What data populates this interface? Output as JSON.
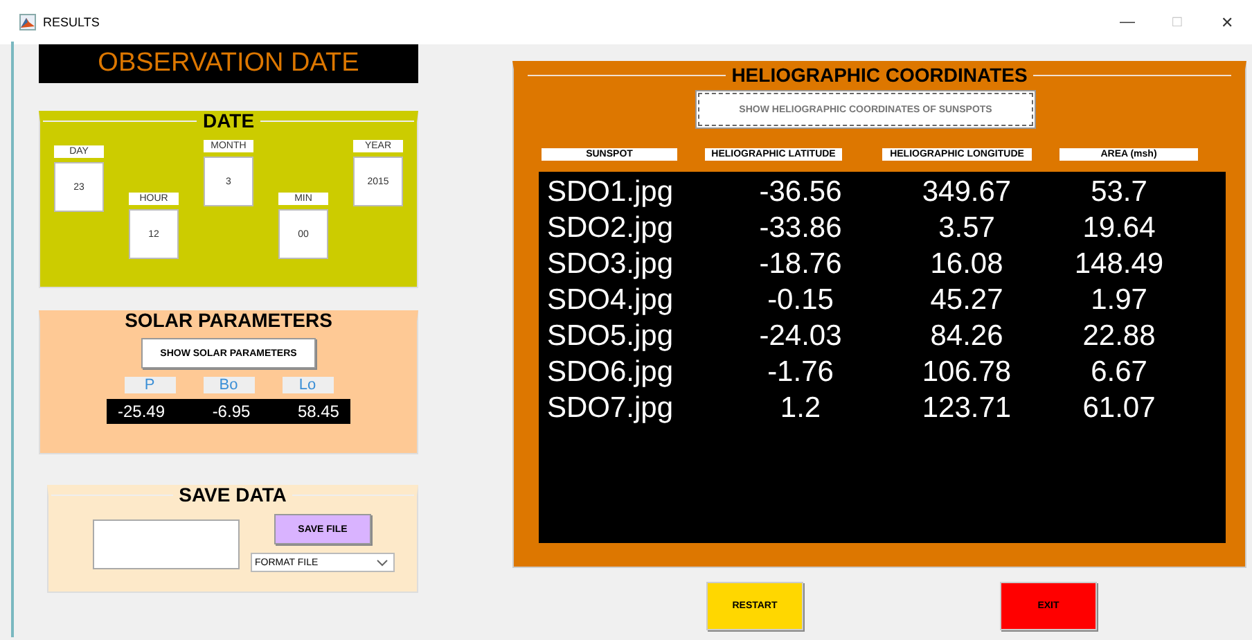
{
  "window": {
    "title": "RESULTS",
    "controls": [
      "—",
      "□",
      "✕"
    ]
  },
  "observation_header": "OBSERVATION DATE",
  "date_panel": {
    "title": "DATE",
    "fields": [
      {
        "label": "DAY",
        "value": "23"
      },
      {
        "label": "HOUR",
        "value": "12"
      },
      {
        "label": "MONTH",
        "value": "3"
      },
      {
        "label": "MIN",
        "value": "00"
      },
      {
        "label": "YEAR",
        "value": "2015"
      }
    ]
  },
  "solar_panel": {
    "title": "SOLAR PARAMETERS",
    "button": "SHOW SOLAR PARAMETERS",
    "labels": [
      "P",
      "Bo",
      "Lo"
    ],
    "values": [
      "-25.49",
      "-6.95",
      "58.45"
    ]
  },
  "save_panel": {
    "title": "SAVE DATA",
    "button": "SAVE FILE",
    "format_select": "FORMAT FILE"
  },
  "helio_panel": {
    "title": "HELIOGRAPHIC COORDINATES",
    "button": "SHOW HELIOGRAPHIC COORDINATES OF SUNSPOTS",
    "columns": [
      "SUNSPOT",
      "HELIOGRAPHIC LATITUDE",
      "HELIOGRAPHIC LONGITUDE",
      "AREA (msh)"
    ],
    "rows": [
      [
        "SDO1.jpg",
        "-36.56",
        "349.67",
        "53.7"
      ],
      [
        "SDO2.jpg",
        "-33.86",
        "3.57",
        "19.64"
      ],
      [
        "SDO3.jpg",
        "-18.76",
        "16.08",
        "148.49"
      ],
      [
        "SDO4.jpg",
        "-0.15",
        "45.27",
        "1.97"
      ],
      [
        "SDO5.jpg",
        "-24.03",
        "84.26",
        "22.88"
      ],
      [
        "SDO6.jpg",
        "-1.76",
        "106.78",
        "6.67"
      ],
      [
        "SDO7.jpg",
        "1.2",
        "123.71",
        "61.07"
      ]
    ]
  },
  "buttons": [
    {
      "label": "RESTART",
      "kind": "restart"
    },
    {
      "label": "EXIT",
      "kind": "exit"
    }
  ]
}
